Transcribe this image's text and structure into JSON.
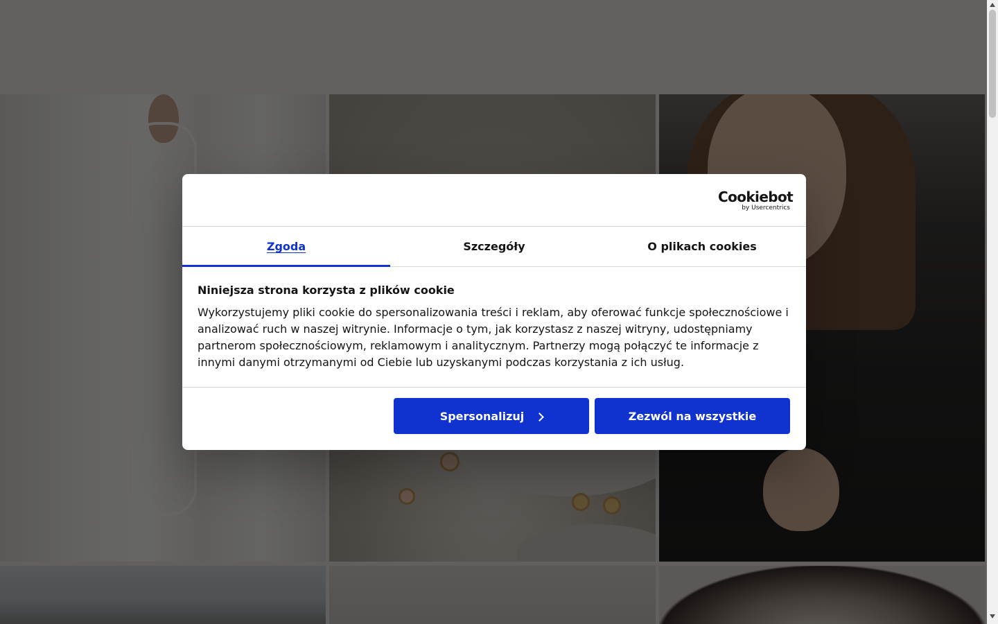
{
  "cookie_dialog": {
    "logo": {
      "name": "Cookiebot",
      "byline": "by Usercentrics"
    },
    "tabs": [
      {
        "label": "Zgoda",
        "active": true
      },
      {
        "label": "Szczegóły",
        "active": false
      },
      {
        "label": "O plikach cookies",
        "active": false
      }
    ],
    "title": "Niniejsza strona korzysta z plików cookie",
    "description": "Wykorzystujemy pliki cookie do spersonalizowania treści i reklam, aby oferować funkcje społecznościowe i analizować ruch w naszej witrynie. Informacje o tym, jak korzystasz z naszej witryny, udostępniamy partnerom społecznościowym, reklamowym i analitycznym. Partnerzy mogą połączyć te informacje z innymi danymi otrzymanymi od Ciebie lub uzyskanymi podczas korzystania z ich usług.",
    "buttons": {
      "customize": {
        "label": "Spersonalizuj",
        "icon": "chevron-right-icon"
      },
      "allow_all": {
        "label": "Zezwól na wszystkie"
      }
    }
  },
  "colors": {
    "accent": "#1032cf",
    "overlay": "rgba(0,0,0,0.58)",
    "text": "#141414"
  }
}
